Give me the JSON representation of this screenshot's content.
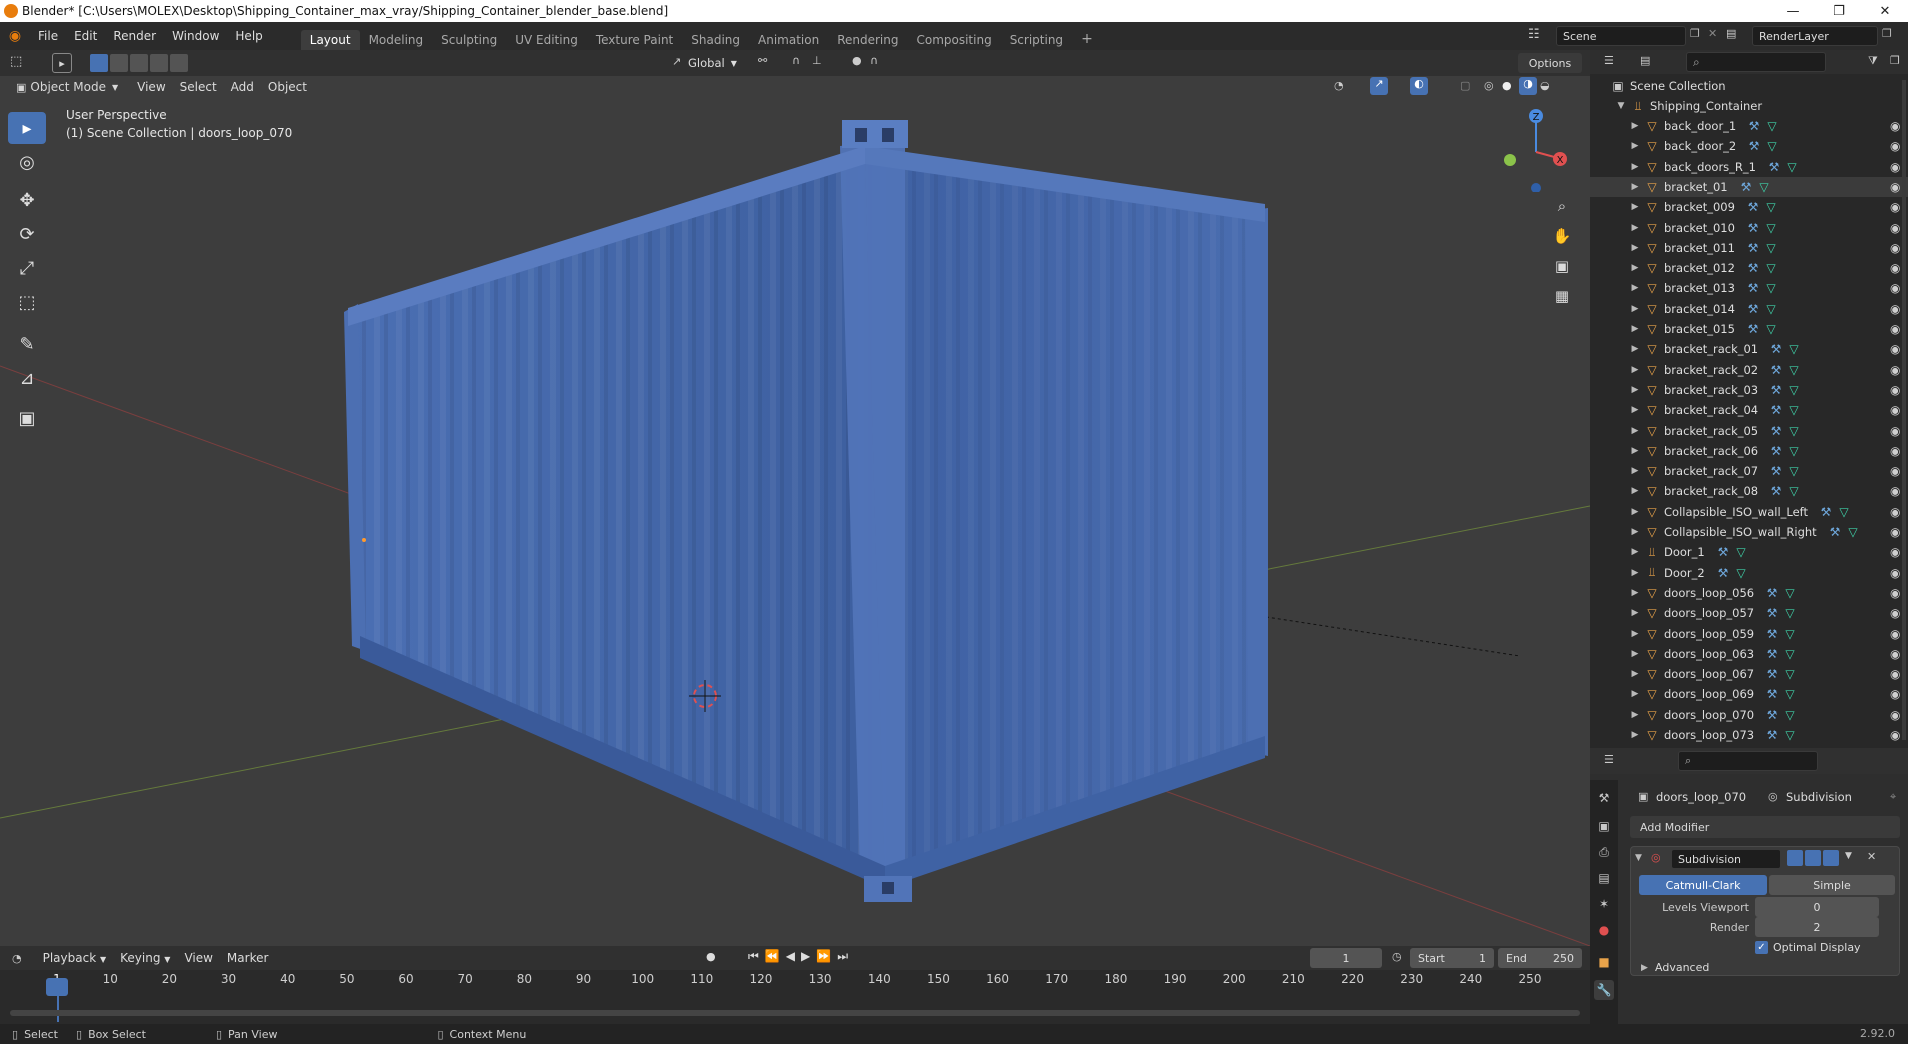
{
  "titlebar": {
    "title": "Blender* [C:\\Users\\MOLEX\\Desktop\\Shipping_Container_max_vray/Shipping_Container_blender_base.blend]"
  },
  "menu": [
    "File",
    "Edit",
    "Render",
    "Window",
    "Help"
  ],
  "workspaces": [
    "Layout",
    "Modeling",
    "Sculpting",
    "UV Editing",
    "Texture Paint",
    "Shading",
    "Animation",
    "Rendering",
    "Compositing",
    "Scripting"
  ],
  "active_workspace": "Layout",
  "scene": {
    "name": "Scene",
    "render_layer": "RenderLayer"
  },
  "tool_header": {
    "orientation": "Global",
    "options": "Options"
  },
  "viewport_header": {
    "mode": "Object Mode",
    "items": [
      "View",
      "Select",
      "Add",
      "Object"
    ]
  },
  "viewport": {
    "perspective": "User Perspective",
    "collection_info": "(1) Scene Collection | doors_loop_070"
  },
  "gizmo": {
    "z": "Z",
    "x": "X"
  },
  "outliner": {
    "root": "Scene Collection",
    "collection": "Shipping_Container",
    "items": [
      {
        "name": "back_door_1",
        "type": "mesh",
        "selected": false
      },
      {
        "name": "back_door_2",
        "type": "mesh",
        "selected": false
      },
      {
        "name": "back_doors_R_1",
        "type": "mesh",
        "selected": false
      },
      {
        "name": "bracket_01",
        "type": "mesh",
        "selected": true
      },
      {
        "name": "bracket_009",
        "type": "mesh",
        "selected": false
      },
      {
        "name": "bracket_010",
        "type": "mesh",
        "selected": false
      },
      {
        "name": "bracket_011",
        "type": "mesh",
        "selected": false
      },
      {
        "name": "bracket_012",
        "type": "mesh",
        "selected": false
      },
      {
        "name": "bracket_013",
        "type": "mesh",
        "selected": false
      },
      {
        "name": "bracket_014",
        "type": "mesh",
        "selected": false
      },
      {
        "name": "bracket_015",
        "type": "mesh",
        "selected": false
      },
      {
        "name": "bracket_rack_01",
        "type": "mesh",
        "selected": false
      },
      {
        "name": "bracket_rack_02",
        "type": "mesh",
        "selected": false
      },
      {
        "name": "bracket_rack_03",
        "type": "mesh",
        "selected": false
      },
      {
        "name": "bracket_rack_04",
        "type": "mesh",
        "selected": false
      },
      {
        "name": "bracket_rack_05",
        "type": "mesh",
        "selected": false
      },
      {
        "name": "bracket_rack_06",
        "type": "mesh",
        "selected": false
      },
      {
        "name": "bracket_rack_07",
        "type": "mesh",
        "selected": false
      },
      {
        "name": "bracket_rack_08",
        "type": "mesh",
        "selected": false
      },
      {
        "name": "Collapsible_ISO_wall_Left",
        "type": "mesh",
        "selected": false
      },
      {
        "name": "Collapsible_ISO_wall_Right",
        "type": "mesh",
        "selected": false
      },
      {
        "name": "Door_1",
        "type": "empty",
        "selected": false
      },
      {
        "name": "Door_2",
        "type": "empty",
        "selected": false
      },
      {
        "name": "doors_loop_056",
        "type": "mesh",
        "selected": false
      },
      {
        "name": "doors_loop_057",
        "type": "mesh",
        "selected": false
      },
      {
        "name": "doors_loop_059",
        "type": "mesh",
        "selected": false
      },
      {
        "name": "doors_loop_063",
        "type": "mesh",
        "selected": false
      },
      {
        "name": "doors_loop_067",
        "type": "mesh",
        "selected": false
      },
      {
        "name": "doors_loop_069",
        "type": "mesh",
        "selected": false
      },
      {
        "name": "doors_loop_070",
        "type": "mesh",
        "selected": false
      },
      {
        "name": "doors_loop_073",
        "type": "mesh",
        "selected": false
      }
    ]
  },
  "properties": {
    "object_name": "doors_loop_070",
    "modifier_tab": "Subdivision",
    "add_modifier": "Add Modifier",
    "modifier_name": "Subdivision",
    "algo_catmull": "Catmull-Clark",
    "algo_simple": "Simple",
    "levels_viewport_label": "Levels Viewport",
    "levels_viewport": "0",
    "render_label": "Render",
    "render_value": "2",
    "optimal_display": "Optimal Display",
    "advanced": "Advanced"
  },
  "timeline": {
    "menus": [
      "Playback",
      "Keying",
      "View",
      "Marker"
    ],
    "current_frame": "1",
    "start_label": "Start",
    "start": "1",
    "end_label": "End",
    "end": "250",
    "ticks": [
      "1",
      "10",
      "20",
      "30",
      "40",
      "50",
      "60",
      "70",
      "80",
      "90",
      "100",
      "110",
      "120",
      "130",
      "140",
      "150",
      "160",
      "170",
      "180",
      "190",
      "200",
      "210",
      "220",
      "230",
      "240",
      "250"
    ]
  },
  "status": {
    "select": "Select",
    "box_select": "Box Select",
    "pan_view": "Pan View",
    "context_menu": "Context Menu",
    "version": "2.92.0"
  },
  "colors": {
    "accent": "#4772b3",
    "container": "#3f63a8",
    "outliner_bg": "#282828"
  }
}
